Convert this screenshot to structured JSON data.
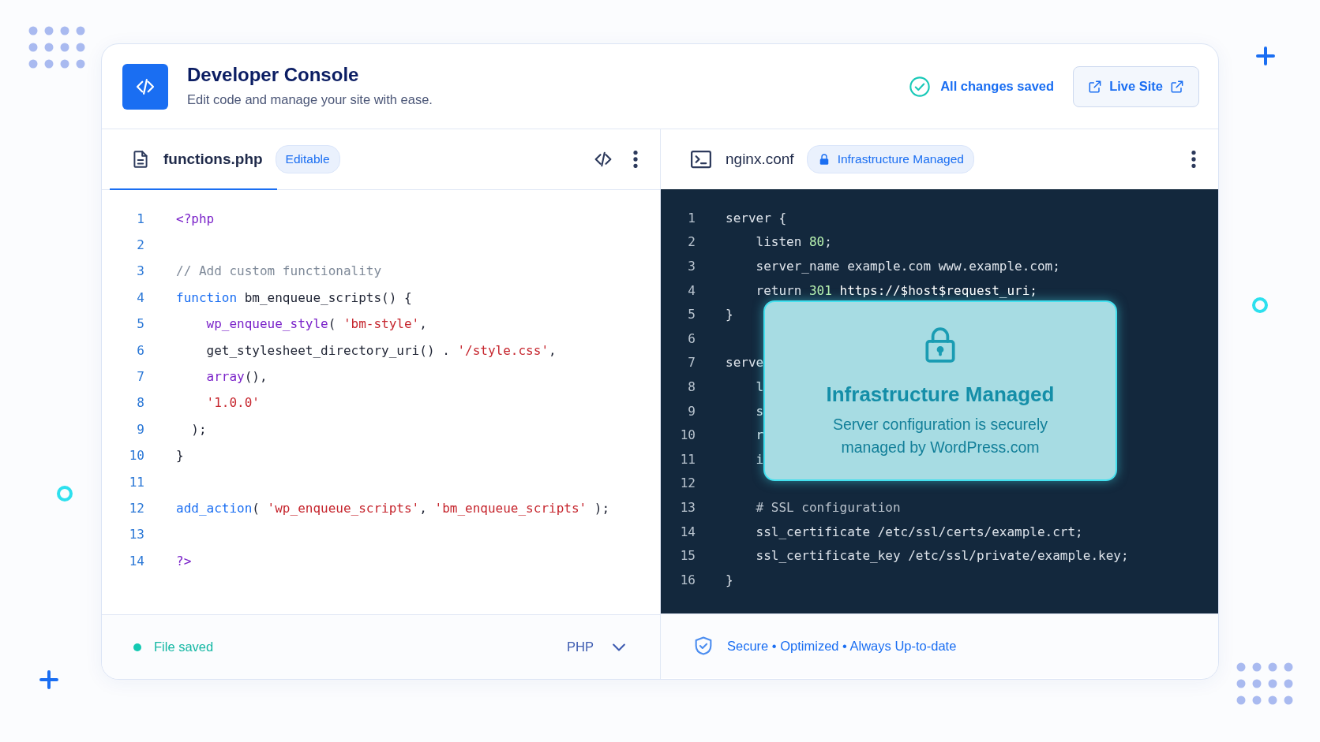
{
  "header": {
    "title": "Developer Console",
    "subtitle": "Edit code and manage your site with ease.",
    "save_status": "All changes saved",
    "live_button": "Live Site"
  },
  "panes": [
    {
      "kind": "editable",
      "filename": "functions.php",
      "badge": "Editable",
      "selected": true,
      "lines": [
        {
          "number": "1",
          "tokens": [
            {
              "kind": "tag",
              "text": "<?php"
            }
          ]
        },
        {
          "number": "2"
        },
        {
          "number": "3",
          "tokens": [
            {
              "kind": "comment",
              "text": "// Add custom functionality"
            }
          ]
        },
        {
          "number": "4",
          "tokens": [
            {
              "kind": "keyword",
              "text": "function"
            },
            {
              "kind": "plain",
              "text": " bm_enqueue_scripts() {"
            }
          ]
        },
        {
          "number": "5",
          "tokens": [
            {
              "kind": "func",
              "text": "    wp_enqueue_style"
            },
            {
              "kind": "plain",
              "text": "( "
            },
            {
              "kind": "string",
              "text": "'bm-style'"
            },
            {
              "kind": "plain",
              "text": ","
            }
          ]
        },
        {
          "number": "6",
          "tokens": [
            {
              "kind": "plain",
              "text": "    get_stylesheet_directory_uri() . "
            },
            {
              "kind": "string",
              "text": "'/style.css'"
            },
            {
              "kind": "plain",
              "text": ","
            }
          ]
        },
        {
          "number": "7",
          "tokens": [
            {
              "kind": "func",
              "text": "    array"
            },
            {
              "kind": "plain",
              "text": "(),"
            }
          ]
        },
        {
          "number": "8",
          "tokens": [
            {
              "kind": "string",
              "text": "    '1.0.0'"
            }
          ]
        },
        {
          "number": "9",
          "tokens": [
            {
              "kind": "plain",
              "text": "  );"
            }
          ]
        },
        {
          "number": "10",
          "tokens": [
            {
              "kind": "plain",
              "text": "}"
            }
          ]
        },
        {
          "number": "11"
        },
        {
          "number": "12",
          "tokens": [
            {
              "kind": "keyword",
              "text": "add_action"
            },
            {
              "kind": "plain",
              "text": "( "
            },
            {
              "kind": "string",
              "text": "'wp_enqueue_scripts'"
            },
            {
              "kind": "plain",
              "text": ", "
            },
            {
              "kind": "string",
              "text": "'bm_enqueue_scripts'"
            },
            {
              "kind": "plain",
              "text": " );"
            }
          ]
        },
        {
          "number": "13"
        },
        {
          "number": "14",
          "tokens": [
            {
              "kind": "tag",
              "text": "?>"
            }
          ]
        }
      ],
      "footer": {
        "status": "File saved",
        "language": "PHP"
      }
    },
    {
      "kind": "managed",
      "filename": "nginx.conf",
      "badge": "Infrastructure Managed",
      "selected": false,
      "lines": [
        {
          "number": "1",
          "tokens": [
            {
              "kind": "plain",
              "text": "server {"
            }
          ]
        },
        {
          "number": "2",
          "tokens": [
            {
              "kind": "plain",
              "text": "    listen "
            },
            {
              "kind": "number",
              "text": "80"
            },
            {
              "kind": "plain",
              "text": ";"
            }
          ]
        },
        {
          "number": "3",
          "tokens": [
            {
              "kind": "plain",
              "text": "    server_name example.com www.example.com;"
            }
          ]
        },
        {
          "number": "4",
          "tokens": [
            {
              "kind": "plain",
              "text": "    return "
            },
            {
              "kind": "number",
              "text": "301"
            },
            {
              "kind": "bright",
              "text": " https://$host$request_uri;"
            }
          ]
        },
        {
          "number": "5",
          "tokens": [
            {
              "kind": "plain",
              "text": "}"
            }
          ]
        },
        {
          "number": "6"
        },
        {
          "number": "7",
          "tokens": [
            {
              "kind": "plain",
              "text": "serve"
            }
          ]
        },
        {
          "number": "8",
          "tokens": [
            {
              "kind": "plain",
              "text": "    l"
            }
          ]
        },
        {
          "number": "9",
          "tokens": [
            {
              "kind": "plain",
              "text": "    s"
            }
          ]
        },
        {
          "number": "10",
          "tokens": [
            {
              "kind": "plain",
              "text": "    r"
            }
          ]
        },
        {
          "number": "11",
          "tokens": [
            {
              "kind": "plain",
              "text": "    i"
            }
          ]
        },
        {
          "number": "12"
        },
        {
          "number": "13",
          "tokens": [
            {
              "kind": "comment",
              "text": "    # SSL configuration"
            }
          ]
        },
        {
          "number": "14",
          "tokens": [
            {
              "kind": "plain",
              "text": "    ssl_certificate /etc/ssl/certs/example.crt;"
            }
          ]
        },
        {
          "number": "15",
          "tokens": [
            {
              "kind": "plain",
              "text": "    ssl_certificate_key /etc/ssl/private/example.key;"
            }
          ]
        },
        {
          "number": "16",
          "tokens": [
            {
              "kind": "plain",
              "text": "}"
            }
          ]
        }
      ],
      "overlay": {
        "title": "Infrastructure Managed",
        "message": "Server configuration is securely managed by WordPress.com"
      },
      "footer": {
        "status": "Secure • Optimized • Always Up-to-date"
      }
    }
  ]
}
